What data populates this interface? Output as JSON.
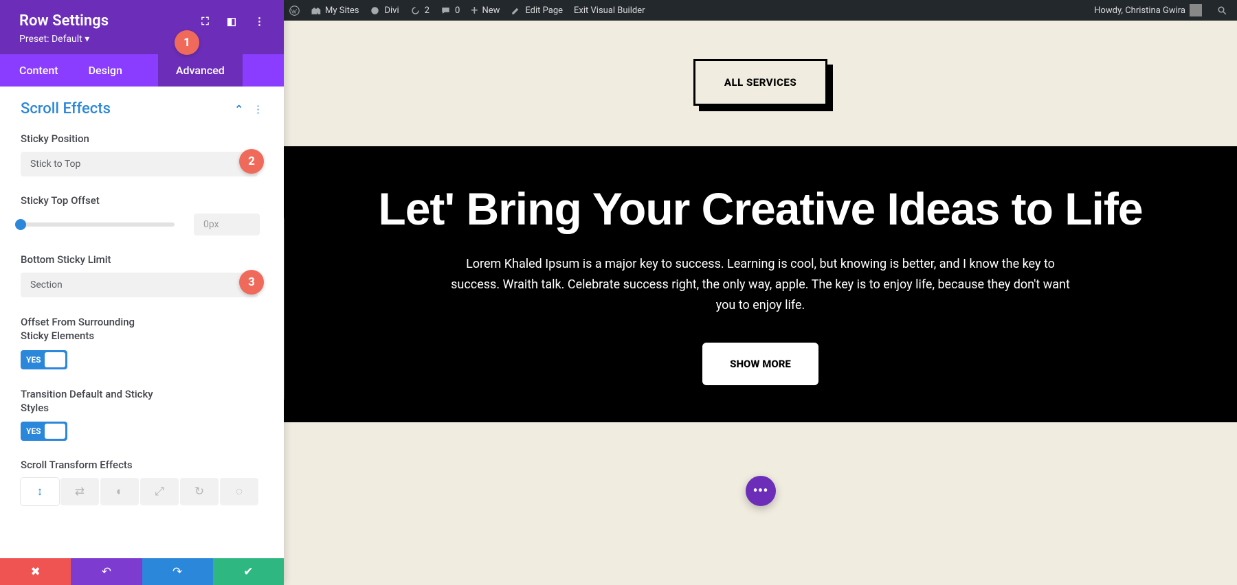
{
  "panel": {
    "title": "Row Settings",
    "preset": "Preset: Default ▾",
    "tabs": {
      "content": "Content",
      "design": "Design",
      "advanced": "Advanced"
    },
    "section": "Scroll Effects",
    "fields": {
      "sticky_position": {
        "label": "Sticky Position",
        "value": "Stick to Top"
      },
      "sticky_top_offset": {
        "label": "Sticky Top Offset",
        "value": "0px"
      },
      "bottom_sticky_limit": {
        "label": "Bottom Sticky Limit",
        "value": "Section"
      },
      "offset_surrounding": {
        "label": "Offset From Surrounding Sticky Elements",
        "toggle": "YES"
      },
      "transition_default": {
        "label": "Transition Default and Sticky Styles",
        "toggle": "YES"
      },
      "scroll_transform": {
        "label": "Scroll Transform Effects"
      }
    },
    "badges": {
      "b1": "1",
      "b2": "2",
      "b3": "3"
    }
  },
  "wpbar": {
    "my_sites": "My Sites",
    "divi": "Divi",
    "updates": "2",
    "comments": "0",
    "new": "New",
    "edit": "Edit Page",
    "exit": "Exit Visual Builder",
    "howdy": "Howdy, Christina Gwira"
  },
  "page": {
    "all_services": "ALL SERVICES",
    "headline": "Let' Bring Your Creative Ideas to Life",
    "body": "Lorem Khaled Ipsum is a major key to success. Learning is cool, but knowing is better, and I know the key to success. Wraith talk. Celebrate success right, the only way, apple. The key is to enjoy life, because they don't want you to enjoy life.",
    "show_more": "SHOW MORE",
    "fab": "•••"
  }
}
